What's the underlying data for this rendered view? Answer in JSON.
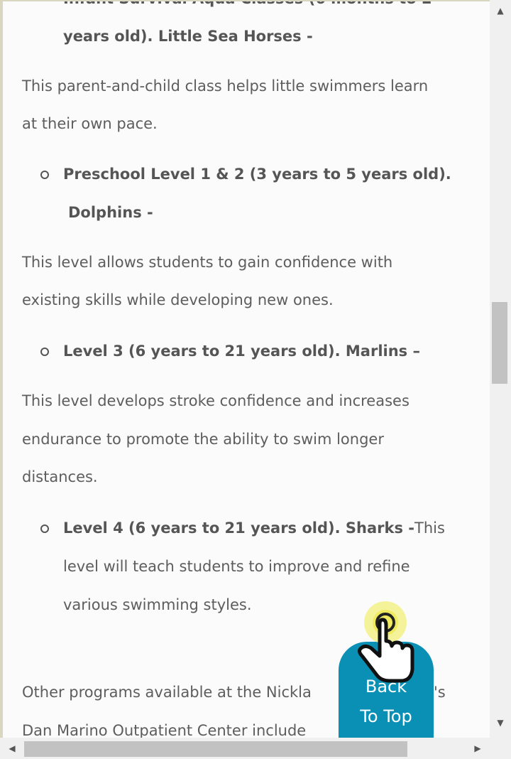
{
  "article": {
    "item0_tail_bold": "years old).  Little Sea Horses -",
    "p1_line1": "This parent-and-child class helps little swimmers learn",
    "p1_line2": "at their own pace.",
    "item1_line1": "Preschool Level 1 & 2 (3 years to 5 years old).",
    "item1_line2": "Dolphins -",
    "p2_line1": "This level allows students to gain confidence with",
    "p2_line2": "existing skills while developing new ones.",
    "item2": "Level 3 (6 years to 21 years old).  Marlins –",
    "p3_line1": "This level develops stroke confidence and increases",
    "p3_line2": "endurance to promote the ability to swim longer",
    "p3_line3": "distances.",
    "item3_bold": "Level 4 (6 years to 21 years old). Sharks -",
    "item3_rest1": "This",
    "item3_line2": "level will teach students to improve and refine",
    "item3_line3": "various swimming styles.",
    "p4_line1": "Other programs available at the Nickla",
    "p4_line1_end": "'s",
    "p4_line2": "Dan Marino Outpatient Center include"
  },
  "back_to_top": {
    "line1": "Back",
    "line2": "To Top"
  },
  "icons": {
    "touch": "touch-hand-icon",
    "scroll_up": "arrow-up-icon",
    "scroll_down": "arrow-down-icon",
    "scroll_left": "arrow-left-icon",
    "scroll_right": "arrow-right-icon"
  },
  "colors": {
    "button": "#0b90b5",
    "text": "#5d5d5d",
    "touch_glow": "#f3f07a"
  }
}
